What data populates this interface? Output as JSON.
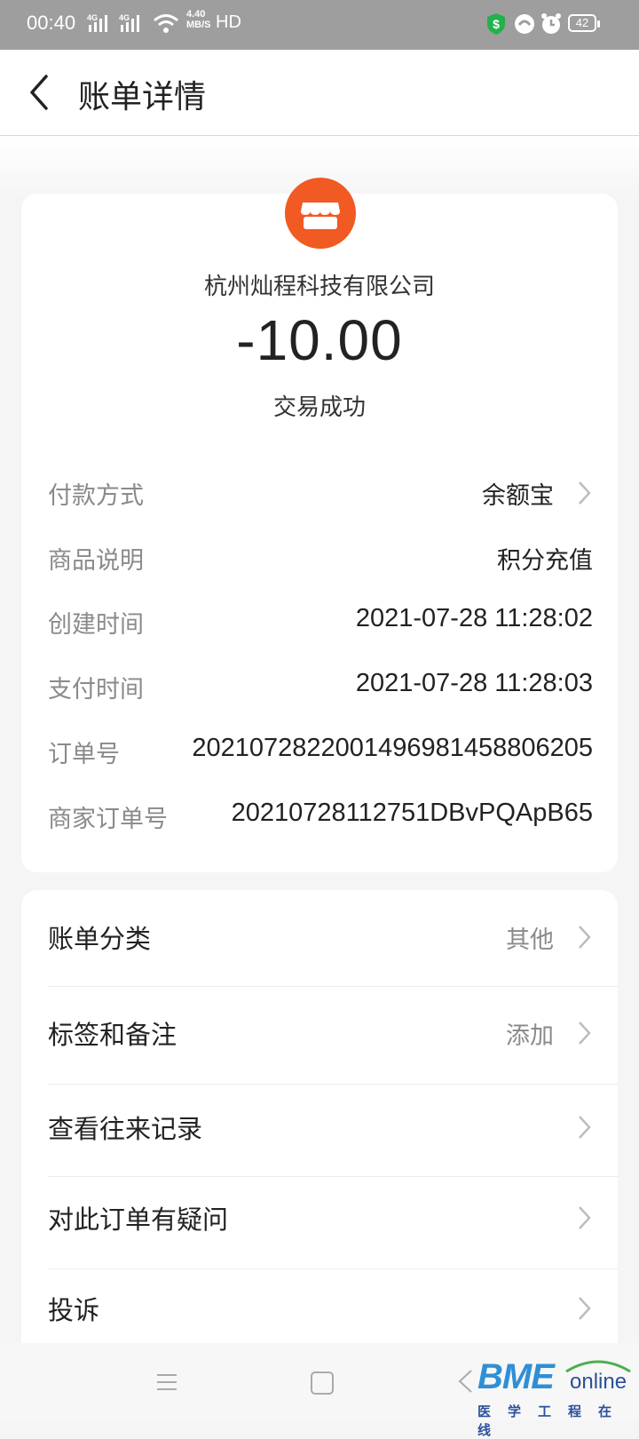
{
  "status_bar": {
    "time": "00:40",
    "signal1_label": "4G",
    "signal2_label": "4G",
    "speed_value": "4.40",
    "speed_unit": "MB/S",
    "hd": "HD",
    "battery": "42",
    "shield_color": "#22b14c"
  },
  "header": {
    "back_icon": "chevron-left-icon",
    "title": "账单详情"
  },
  "summary": {
    "shop_icon": "storefront-icon",
    "icon_color": "#f15a22",
    "merchant": "杭州灿程科技有限公司",
    "amount": "-10.00",
    "status": "交易成功"
  },
  "details": [
    {
      "label": "付款方式",
      "value": "余额宝",
      "has_chevron": true
    },
    {
      "label": "商品说明",
      "value": "积分充值"
    },
    {
      "label": "创建时间",
      "value": "2021-07-28 11:28:02"
    },
    {
      "label": "支付时间",
      "value": "2021-07-28 11:28:03"
    },
    {
      "label": "订单号",
      "value": "2021072822001496981458806205"
    },
    {
      "label": "商家订单号",
      "value": "20210728112751DBvPQApB65"
    }
  ],
  "actions": [
    {
      "label": "账单分类",
      "side": "其他"
    },
    {
      "label": "标签和备注",
      "side": "添加"
    },
    {
      "label": "查看往来记录",
      "side": ""
    },
    {
      "label": "对此订单有疑问",
      "side": ""
    },
    {
      "label": "投诉",
      "side": ""
    }
  ],
  "nav": {
    "menu_icon": "menu-icon",
    "home_icon": "home-square-icon",
    "back_icon": "back-triangle-icon"
  },
  "watermark": {
    "logo": "BME",
    "online": "online",
    "subtitle": "医学工程在线"
  }
}
